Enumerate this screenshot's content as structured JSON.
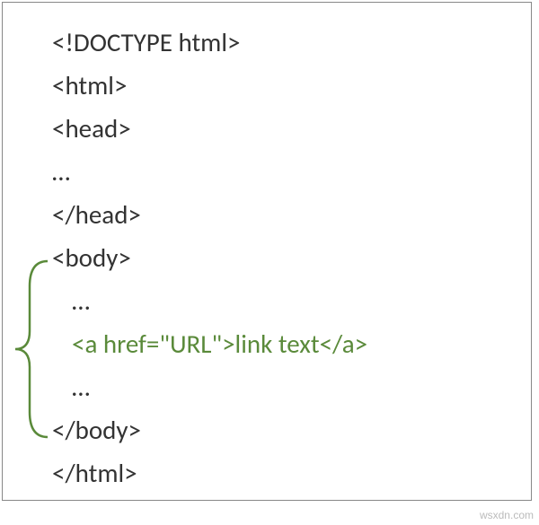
{
  "lines": {
    "l0": "<!DOCTYPE html>",
    "l1": "<html>",
    "l2": "<head>",
    "l3": "…",
    "l4": "</head>",
    "l5": "<body>",
    "l6": "…",
    "l7": "<a href=\"URL\">link text</a>",
    "l8": "…",
    "l9": "</body>",
    "l10": "</html>"
  },
  "watermark": "wsxdn.com",
  "colors": {
    "highlight": "#5a8a3a",
    "text": "#333333",
    "border": "#888888"
  }
}
